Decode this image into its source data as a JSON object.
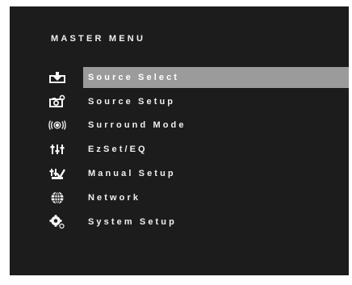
{
  "menu": {
    "title": "MASTER MENU",
    "selected_index": 0,
    "items": [
      {
        "label": "Source Select",
        "icon": "source-select-icon"
      },
      {
        "label": "Source Setup",
        "icon": "source-setup-icon"
      },
      {
        "label": "Surround Mode",
        "icon": "surround-mode-icon"
      },
      {
        "label": "EzSet/EQ",
        "icon": "ezset-eq-icon"
      },
      {
        "label": "Manual Setup",
        "icon": "manual-setup-icon"
      },
      {
        "label": "Network",
        "icon": "network-icon"
      },
      {
        "label": "System Setup",
        "icon": "system-setup-icon"
      }
    ]
  },
  "colors": {
    "background": "#1c1c1c",
    "highlight": "#9b9b9b",
    "text": "#f0f0f0"
  }
}
